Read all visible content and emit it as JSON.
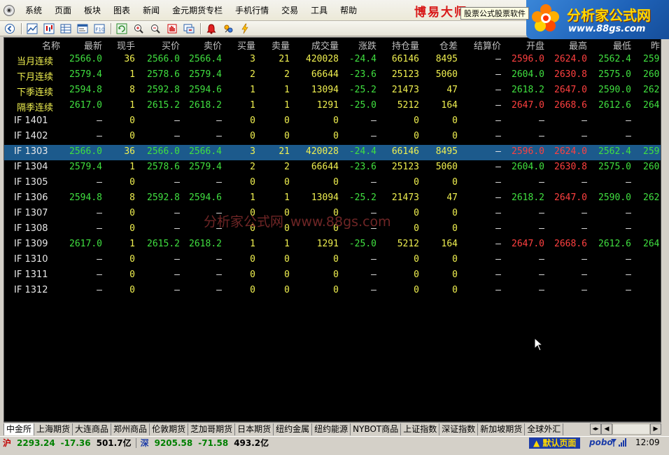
{
  "menu": {
    "items": [
      "系统",
      "页面",
      "板块",
      "图表",
      "新闻",
      "金元期货专栏",
      "手机行情",
      "交易",
      "工具",
      "帮助"
    ]
  },
  "brand": {
    "red_text": "博易大师",
    "tooltip": "股票公式股票软件",
    "logo_title": "分析家公式网",
    "logo_url": "www.88gs.com"
  },
  "toolbar": {
    "icons": [
      "back-icon",
      "line-chart-icon",
      "candlestick-icon",
      "table-icon",
      "quote-window-icon",
      "f10-icon",
      "refresh-icon",
      "zoom-in-icon",
      "zoom-out-icon",
      "hand-icon",
      "window-cycle-icon",
      "alarm-icon",
      "indicator-icon",
      "lightning-icon"
    ]
  },
  "colors": {
    "background": "#000000",
    "header_text": "#c0c0c0",
    "yellow": "#f0f050",
    "green": "#40e040",
    "red": "#ff4040",
    "white": "#e8e8e8",
    "selected_row": "#1c5a8c"
  },
  "table": {
    "headers": [
      "名称",
      "最新",
      "现手",
      "买价",
      "卖价",
      "买量",
      "卖量",
      "成交量",
      "涨跌",
      "持仓量",
      "仓差",
      "结算价",
      "开盘",
      "最高",
      "最低",
      "昨收"
    ],
    "rows": [
      {
        "name": "当月连续",
        "name_color": "yellow",
        "latest": "2566.0",
        "vol": "36",
        "bid": "2566.0",
        "ask": "2566.4",
        "bidvol": "3",
        "askvol": "21",
        "volume": "420028",
        "change": "-24.4",
        "oi": "66146",
        "oi_chg": "8495",
        "settle": "—",
        "open": "2596.0",
        "high": "2624.0",
        "low": "2562.4",
        "prev": "259",
        "selected": false
      },
      {
        "name": "下月连续",
        "name_color": "yellow",
        "latest": "2579.4",
        "vol": "1",
        "bid": "2578.6",
        "ask": "2579.4",
        "bidvol": "2",
        "askvol": "2",
        "volume": "66644",
        "change": "-23.6",
        "oi": "25123",
        "oi_chg": "5060",
        "settle": "—",
        "open": "2604.0",
        "high": "2630.8",
        "low": "2575.0",
        "prev": "260",
        "selected": false
      },
      {
        "name": "下季连续",
        "name_color": "yellow",
        "latest": "2594.8",
        "vol": "8",
        "bid": "2592.8",
        "ask": "2594.6",
        "bidvol": "1",
        "askvol": "1",
        "volume": "13094",
        "change": "-25.2",
        "oi": "21473",
        "oi_chg": "47",
        "settle": "—",
        "open": "2618.2",
        "high": "2647.0",
        "low": "2590.0",
        "prev": "262",
        "selected": false
      },
      {
        "name": "隔季连续",
        "name_color": "yellow",
        "latest": "2617.0",
        "vol": "1",
        "bid": "2615.2",
        "ask": "2618.2",
        "bidvol": "1",
        "askvol": "1",
        "volume": "1291",
        "change": "-25.0",
        "oi": "5212",
        "oi_chg": "164",
        "settle": "—",
        "open": "2647.0",
        "high": "2668.6",
        "low": "2612.6",
        "prev": "264",
        "selected": false
      },
      {
        "name": "IF  1401",
        "name_color": "white",
        "latest": "—",
        "vol": "0",
        "bid": "—",
        "ask": "—",
        "bidvol": "0",
        "askvol": "0",
        "volume": "0",
        "change": "—",
        "oi": "0",
        "oi_chg": "0",
        "settle": "—",
        "open": "—",
        "high": "—",
        "low": "—",
        "prev": "",
        "selected": false
      },
      {
        "name": "IF  1402",
        "name_color": "white",
        "latest": "—",
        "vol": "0",
        "bid": "—",
        "ask": "—",
        "bidvol": "0",
        "askvol": "0",
        "volume": "0",
        "change": "—",
        "oi": "0",
        "oi_chg": "0",
        "settle": "—",
        "open": "—",
        "high": "—",
        "low": "—",
        "prev": "",
        "selected": false
      },
      {
        "name": "IF  1303",
        "name_color": "white",
        "latest": "2566.0",
        "vol": "36",
        "bid": "2566.0",
        "ask": "2566.4",
        "bidvol": "3",
        "askvol": "21",
        "volume": "420028",
        "change": "-24.4",
        "oi": "66146",
        "oi_chg": "8495",
        "settle": "—",
        "open": "2596.0",
        "high": "2624.0",
        "low": "2562.4",
        "prev": "259",
        "selected": true
      },
      {
        "name": "IF  1304",
        "name_color": "white",
        "latest": "2579.4",
        "vol": "1",
        "bid": "2578.6",
        "ask": "2579.4",
        "bidvol": "2",
        "askvol": "2",
        "volume": "66644",
        "change": "-23.6",
        "oi": "25123",
        "oi_chg": "5060",
        "settle": "—",
        "open": "2604.0",
        "high": "2630.8",
        "low": "2575.0",
        "prev": "260",
        "selected": false
      },
      {
        "name": "IF  1305",
        "name_color": "white",
        "latest": "—",
        "vol": "0",
        "bid": "—",
        "ask": "—",
        "bidvol": "0",
        "askvol": "0",
        "volume": "0",
        "change": "—",
        "oi": "0",
        "oi_chg": "0",
        "settle": "—",
        "open": "—",
        "high": "—",
        "low": "—",
        "prev": "",
        "selected": false
      },
      {
        "name": "IF  1306",
        "name_color": "white",
        "latest": "2594.8",
        "vol": "8",
        "bid": "2592.8",
        "ask": "2594.6",
        "bidvol": "1",
        "askvol": "1",
        "volume": "13094",
        "change": "-25.2",
        "oi": "21473",
        "oi_chg": "47",
        "settle": "—",
        "open": "2618.2",
        "high": "2647.0",
        "low": "2590.0",
        "prev": "262",
        "selected": false
      },
      {
        "name": "IF  1307",
        "name_color": "white",
        "latest": "—",
        "vol": "0",
        "bid": "—",
        "ask": "—",
        "bidvol": "0",
        "askvol": "0",
        "volume": "0",
        "change": "—",
        "oi": "0",
        "oi_chg": "0",
        "settle": "—",
        "open": "—",
        "high": "—",
        "low": "—",
        "prev": "",
        "selected": false
      },
      {
        "name": "IF  1308",
        "name_color": "white",
        "latest": "—",
        "vol": "0",
        "bid": "—",
        "ask": "—",
        "bidvol": "0",
        "askvol": "0",
        "volume": "0",
        "change": "—",
        "oi": "0",
        "oi_chg": "0",
        "settle": "—",
        "open": "—",
        "high": "—",
        "low": "—",
        "prev": "",
        "selected": false
      },
      {
        "name": "IF  1309",
        "name_color": "white",
        "latest": "2617.0",
        "vol": "1",
        "bid": "2615.2",
        "ask": "2618.2",
        "bidvol": "1",
        "askvol": "1",
        "volume": "1291",
        "change": "-25.0",
        "oi": "5212",
        "oi_chg": "164",
        "settle": "—",
        "open": "2647.0",
        "high": "2668.6",
        "low": "2612.6",
        "prev": "264",
        "selected": false
      },
      {
        "name": "IF  1310",
        "name_color": "white",
        "latest": "—",
        "vol": "0",
        "bid": "—",
        "ask": "—",
        "bidvol": "0",
        "askvol": "0",
        "volume": "0",
        "change": "—",
        "oi": "0",
        "oi_chg": "0",
        "settle": "—",
        "open": "—",
        "high": "—",
        "low": "—",
        "prev": "",
        "selected": false
      },
      {
        "name": "IF  1311",
        "name_color": "white",
        "latest": "—",
        "vol": "0",
        "bid": "—",
        "ask": "—",
        "bidvol": "0",
        "askvol": "0",
        "volume": "0",
        "change": "—",
        "oi": "0",
        "oi_chg": "0",
        "settle": "—",
        "open": "—",
        "high": "—",
        "low": "—",
        "prev": "",
        "selected": false
      },
      {
        "name": "IF  1312",
        "name_color": "white",
        "latest": "—",
        "vol": "0",
        "bid": "—",
        "ask": "—",
        "bidvol": "0",
        "askvol": "0",
        "volume": "0",
        "change": "—",
        "oi": "0",
        "oi_chg": "0",
        "settle": "—",
        "open": "—",
        "high": "—",
        "low": "—",
        "prev": "",
        "selected": false
      }
    ]
  },
  "watermark": {
    "cn": "分析家公式网",
    "url": "www.88gs.com"
  },
  "market_tabs": [
    "中金所",
    "上海期货",
    "大连商品",
    "郑州商品",
    "伦敦期货",
    "芝加哥期货",
    "日本期货",
    "纽约金属",
    "纽约能源",
    "NYBOT商品",
    "上证指数",
    "深证指数",
    "新加坡期货",
    "全球外汇"
  ],
  "statusbar": {
    "sh_label": "沪",
    "sh_index": "2293.24",
    "sh_change": "-17.36",
    "sh_amount": "501.7亿",
    "sz_label": "深",
    "sz_index": "9205.58",
    "sz_change": "-71.58",
    "sz_amount": "493.2亿",
    "default_page": "▲ 默认页面",
    "pobo": "pobo",
    "time": "12:09"
  }
}
